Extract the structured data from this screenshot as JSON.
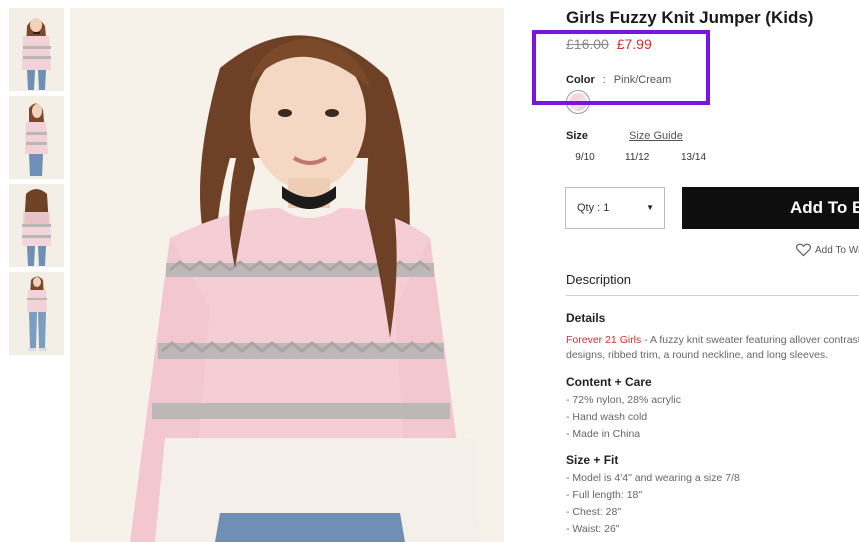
{
  "product": {
    "title": "Girls Fuzzy Knit Jumper (Kids)",
    "old_price": "£16.00",
    "sale_price": "£7.99"
  },
  "color": {
    "label": "Color",
    "separator": ":",
    "value": "Pink/Cream"
  },
  "size": {
    "label": "Size",
    "guide_label": "Size Guide",
    "options": [
      "9/10",
      "11/12",
      "13/14"
    ]
  },
  "quantity": {
    "label": "Qty : 1"
  },
  "add_button_label": "Add To Bag",
  "wishlist_label": "Add To Wishlist",
  "description": {
    "heading": "Description",
    "details": {
      "heading": "Details",
      "brand": "Forever 21 Girls",
      "text": " - A fuzzy knit sweater featuring allover contrast designs, ribbed trim, a round neckline, and long sleeves."
    },
    "content_care": {
      "heading": "Content + Care",
      "items": [
        "- 72% nylon, 28% acrylic",
        "- Hand wash cold",
        "- Made in China"
      ]
    },
    "size_fit": {
      "heading": "Size + Fit",
      "items": [
        "- Model is 4'4\" and wearing a size 7/8",
        "- Full length: 18\"",
        "- Chest: 28\"",
        "- Waist: 26\""
      ]
    }
  },
  "colors": {
    "sale": "#d0312d",
    "highlight": "#7a14e0",
    "button_bg": "#0e0e0e"
  },
  "icons": [
    "heart-icon",
    "dropdown-arrow-icon"
  ]
}
